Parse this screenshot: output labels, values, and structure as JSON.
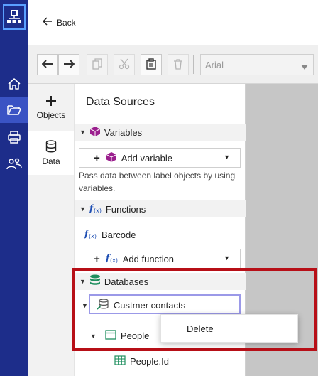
{
  "nav": {
    "back_label": "Back"
  },
  "toolbar": {
    "font_value": "Arial"
  },
  "side_tabs": [
    {
      "label": "Objects",
      "icon": "plus-icon"
    },
    {
      "label": "Data",
      "icon": "database-icon"
    }
  ],
  "panel": {
    "title": "Data Sources",
    "variables": {
      "header": "Variables",
      "add_label": "Add variable",
      "description": "Pass data between label objects by using variables."
    },
    "functions": {
      "header": "Functions",
      "item": "Barcode",
      "add_label": "Add function"
    },
    "databases": {
      "header": "Databases",
      "connection": "Custmer contacts",
      "table": "People",
      "field": "People.Id"
    }
  },
  "context_menu": {
    "delete_label": "Delete"
  },
  "colors": {
    "rail": "#1d2d8a",
    "rail_active": "#3a53c4",
    "highlight": "#b70f17",
    "variable_icon": "#9b1f8e",
    "function_icon": "#1f4fb3",
    "database_icon": "#1f8f5f"
  }
}
